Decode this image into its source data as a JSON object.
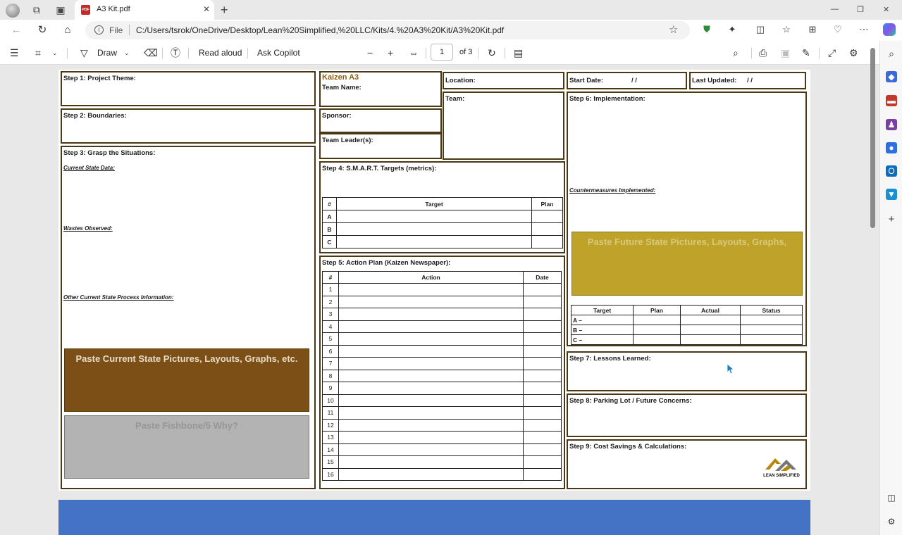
{
  "browser": {
    "tab_title": "A3 Kit.pdf",
    "tab_close": "✕",
    "new_tab": "+",
    "address_label": "File",
    "url": "C:/Users/tsrok/OneDrive/Desktop/Lean%20Simplified,%20LLC/Kits/4.%20A3%20Kit/A3%20Kit.pdf",
    "window_controls": [
      "—",
      "❐",
      "✕"
    ]
  },
  "pdf_toolbar": {
    "draw_label": "Draw",
    "read_aloud_label": "Read aloud",
    "ask_copilot_label": "Ask Copilot",
    "page_number": "1",
    "page_count": "of 3"
  },
  "a3": {
    "step1": "Step 1: Project Theme:",
    "step2": "Step 2: Boundaries:",
    "step3": "Step 3: Grasp the Situations:",
    "current_state_data": "Current State Data:",
    "wastes_observed": "Wastes Observed:",
    "other_info": "Other Current State Process Information:",
    "paste_current": "Paste Current State Pictures, Layouts, Graphs, etc.",
    "paste_fishbone": "Paste Fishbone/5 Why?",
    "kaizen_title": "Kaizen A3",
    "team_name": "Team Name:",
    "sponsor": "Sponsor:",
    "team_leader": "Team Leader(s):",
    "location": "Location:",
    "team": "Team:",
    "start_date": "Start Date:",
    "start_date_value": "/      /",
    "last_updated": "Last Updated:",
    "last_updated_value": "/      /",
    "step4": "Step 4: S.M.A.R.T. Targets  (metrics):",
    "step4_headers": [
      "#",
      "Target",
      "Plan"
    ],
    "step4_rows": [
      "A",
      "B",
      "C"
    ],
    "step5": "Step 5: Action Plan (Kaizen Newspaper):",
    "step5_headers": [
      "#",
      "Action",
      "Date"
    ],
    "step5_rows": [
      "1",
      "2",
      "3",
      "4",
      "5",
      "6",
      "7",
      "8",
      "9",
      "10",
      "11",
      "12",
      "13",
      "14",
      "15",
      "16"
    ],
    "step6": "Step 6: Implementation:",
    "countermeasures": "Countermeasures Implemented:",
    "paste_future": "Paste Future State Pictures, Layouts, Graphs,",
    "step6_headers": [
      "Target",
      "Plan",
      "Actual",
      "Status"
    ],
    "step6_rows": [
      "A –",
      "B –",
      "C –"
    ],
    "step7": "Step 7: Lessons Learned:",
    "step8": "Step 8: Parking Lot / Future Concerns:",
    "step9": "Step 9: Cost Savings & Calculations:",
    "logo_text": "LEAN SIMPLIFIED",
    "colors": {
      "border": "#4a3716",
      "kaizen_title": "#8b5e16",
      "paste_current_bg": "#7b4f15",
      "paste_fishbone_bg": "#b3b3b3",
      "paste_future_bg": "#bfa22a",
      "page2_banner": "#4472c4"
    }
  }
}
